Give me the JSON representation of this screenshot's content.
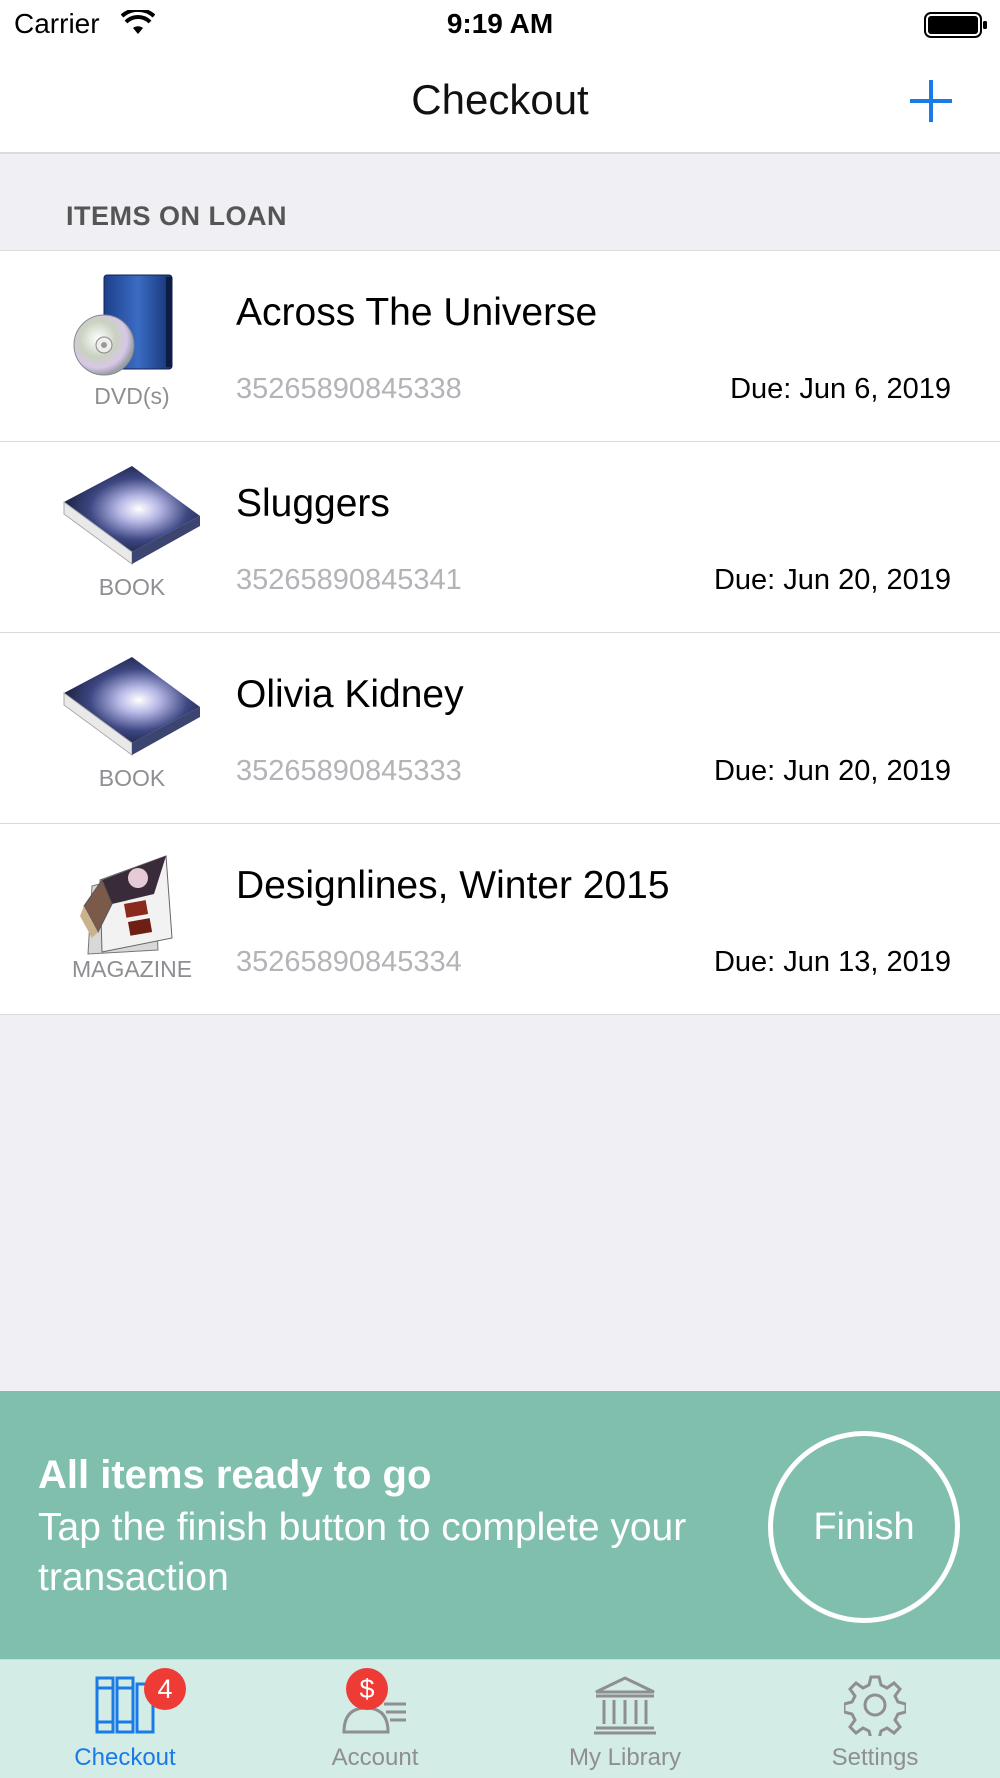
{
  "status_bar": {
    "carrier": "Carrier",
    "time": "9:19 AM"
  },
  "nav": {
    "title": "Checkout",
    "add_icon": "plus-icon"
  },
  "section": {
    "title": "ITEMS ON LOAN"
  },
  "items": [
    {
      "title": "Across The Universe",
      "type": "DVD(s)",
      "barcode": "35265890845338",
      "due": "Due: Jun 6, 2019",
      "icon": "dvd-icon"
    },
    {
      "title": "Sluggers",
      "type": "BOOK",
      "barcode": "35265890845341",
      "due": "Due: Jun 20, 2019",
      "icon": "book-icon"
    },
    {
      "title": "Olivia Kidney",
      "type": "BOOK",
      "barcode": "35265890845333",
      "due": "Due: Jun 20, 2019",
      "icon": "book-icon"
    },
    {
      "title": "Designlines, Winter 2015",
      "type": "MAGAZINE",
      "barcode": "35265890845334",
      "due": "Due: Jun 13, 2019",
      "icon": "magazine-icon"
    }
  ],
  "banner": {
    "headline": "All items ready to go",
    "message": "Tap the finish button to complete your transaction",
    "finish_label": "Finish",
    "color": "#80bfad"
  },
  "tabs": [
    {
      "label": "Checkout",
      "badge": "4",
      "icon": "books-icon",
      "active": true
    },
    {
      "label": "Account",
      "badge": "$",
      "icon": "account-icon",
      "active": false
    },
    {
      "label": "My Library",
      "icon": "library-icon",
      "active": false
    },
    {
      "label": "Settings",
      "icon": "gear-icon",
      "active": false
    }
  ],
  "colors": {
    "accent": "#1a7ae6",
    "badge": "#ee3b36",
    "tab_bar": "#d3ece6"
  }
}
